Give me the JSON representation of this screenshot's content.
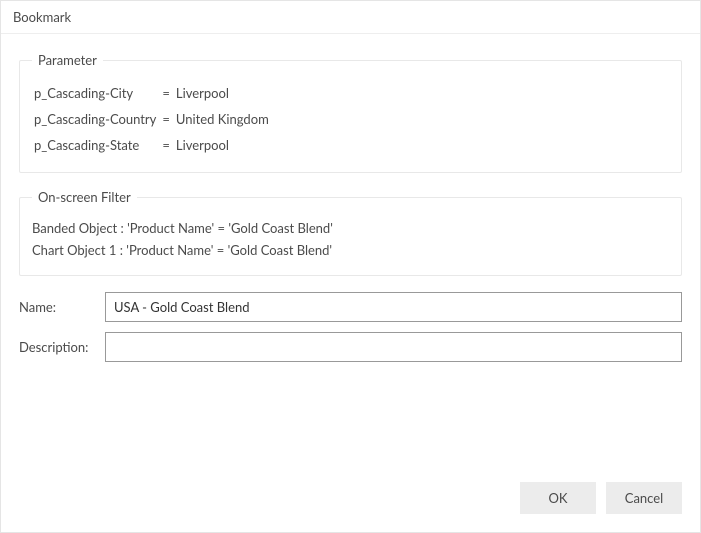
{
  "dialog": {
    "title": "Bookmark"
  },
  "parameter": {
    "legend": "Parameter",
    "rows": [
      {
        "name": "p_Cascading-City",
        "eq": "=",
        "value": "Liverpool"
      },
      {
        "name": "p_Cascading-Country",
        "eq": "=",
        "value": "United Kingdom"
      },
      {
        "name": "p_Cascading-State",
        "eq": "=",
        "value": "Liverpool"
      }
    ]
  },
  "filter": {
    "legend": "On-screen Filter",
    "lines": [
      "Banded Object : 'Product Name' = 'Gold Coast Blend'",
      "Chart Object 1 : 'Product Name' = 'Gold Coast Blend'"
    ]
  },
  "form": {
    "name_label": "Name:",
    "name_value": "USA - Gold Coast Blend",
    "description_label": "Description:",
    "description_value": ""
  },
  "buttons": {
    "ok": "OK",
    "cancel": "Cancel"
  }
}
